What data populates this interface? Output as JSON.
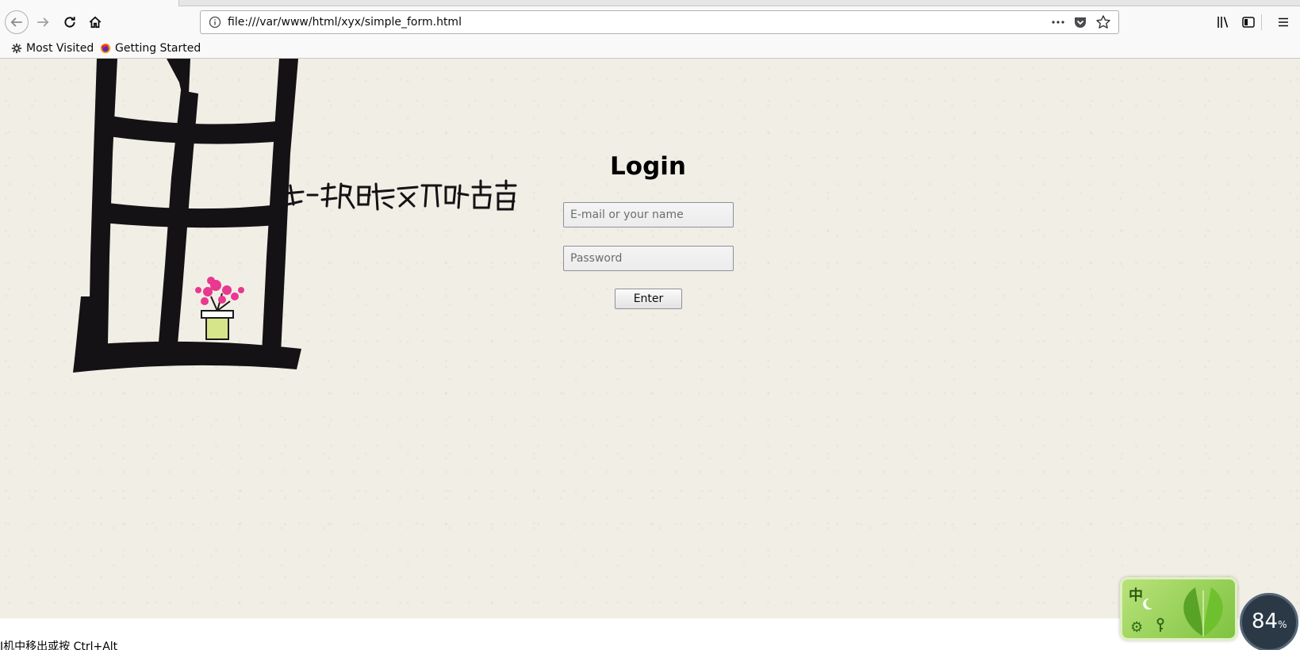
{
  "browser": {
    "url": "file:///var/www/html/xyx/simple_form.html",
    "bookmarks": [
      {
        "label": "Most Visited",
        "icon": "gear-icon"
      },
      {
        "label": "Getting Started",
        "icon": "firefox-icon"
      }
    ],
    "colors": {
      "chrome_bg": "#f9f9fa",
      "border": "#b1b1b3"
    }
  },
  "page": {
    "login_title": "Login",
    "email_placeholder": "E-mail or your name",
    "password_placeholder": "Password",
    "enter_label": "Enter",
    "background_color": "#f1eee6"
  },
  "overlay": {
    "status_fragment": "I机中移出或按 Ctrl+Alt",
    "ime_mode": "中",
    "gauge_value": "84",
    "gauge_unit": "%"
  }
}
